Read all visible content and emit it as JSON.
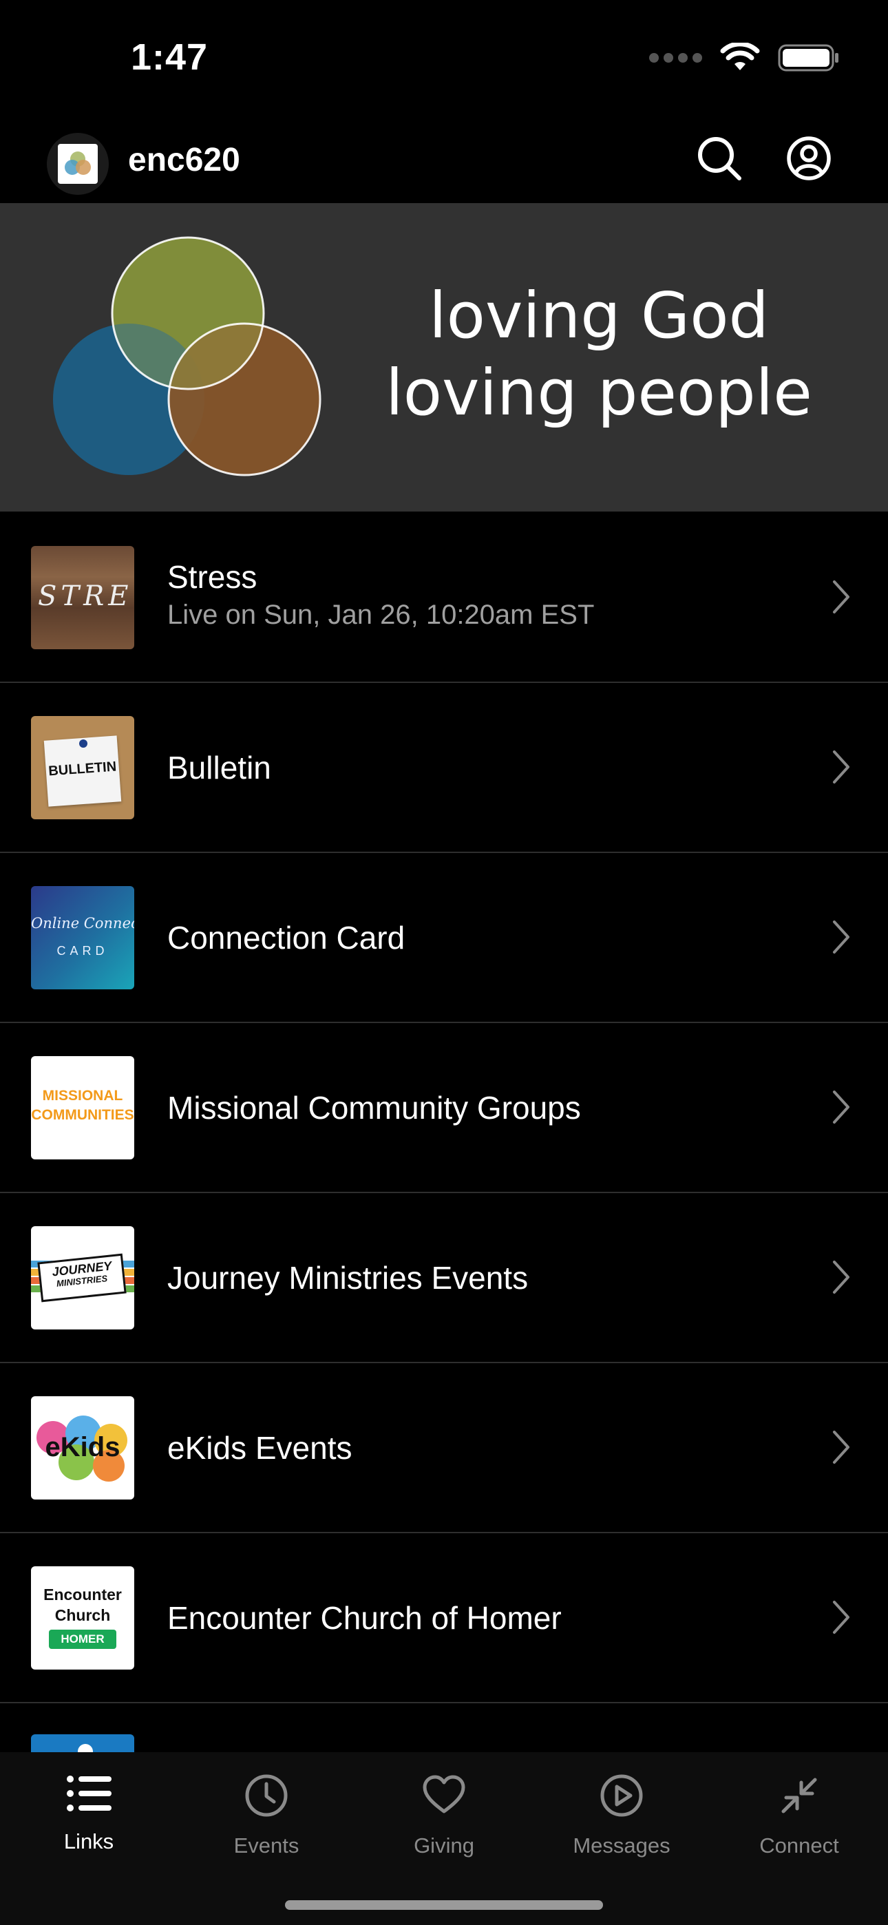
{
  "status_bar": {
    "time": "1:47"
  },
  "header": {
    "app_name": "enc620"
  },
  "hero": {
    "line1": "loving God",
    "line2": "loving people"
  },
  "list_items": [
    {
      "title": "Stress",
      "subtitle": "Live on Sun, Jan 26, 10:20am EST",
      "thumb_text": "STRE"
    },
    {
      "title": "Bulletin",
      "thumb_text": "BULLETIN"
    },
    {
      "title": "Connection Card",
      "thumb_text": "Online Connection",
      "thumb_text2": "CARD"
    },
    {
      "title": "Missional Community Groups",
      "thumb_text": "MISSIONAL",
      "thumb_text2": "COMMUNITIES"
    },
    {
      "title": "Journey Ministries Events",
      "thumb_text": "JOURNEY",
      "thumb_text2": "MINISTRIES"
    },
    {
      "title": "eKids Events",
      "thumb_text": "eKids"
    },
    {
      "title": "Encounter Church of Homer",
      "thumb_text": "Encounter",
      "thumb_text2": "Church",
      "thumb_text3": "HOMER"
    }
  ],
  "tabs": [
    {
      "label": "Links",
      "icon": "list-icon",
      "active": true
    },
    {
      "label": "Events",
      "icon": "clock-icon"
    },
    {
      "label": "Giving",
      "icon": "heart-icon"
    },
    {
      "label": "Messages",
      "icon": "play-circle-icon"
    },
    {
      "label": "Connect",
      "icon": "compress-arrows-icon"
    }
  ],
  "colors": {
    "background": "#000000",
    "hero_background": "#323232",
    "circle_green": "#7a8a34",
    "circle_blue": "#1d6a8f",
    "circle_brown": "#8a5a2a",
    "tab_inactive": "#8a8a8a"
  }
}
